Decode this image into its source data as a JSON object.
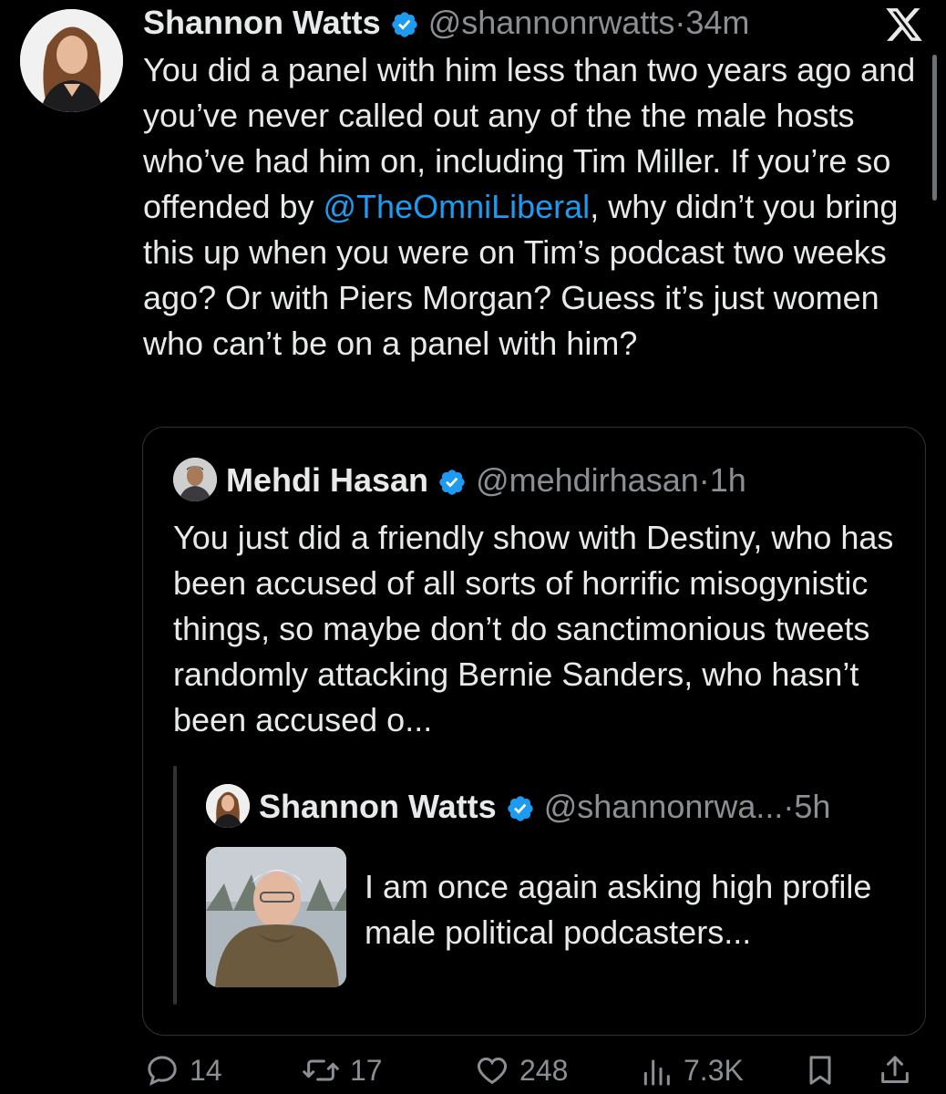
{
  "main_tweet": {
    "author_name": "Shannon Watts",
    "handle": "@shannonrwatts",
    "separator": "·",
    "time": "34m",
    "text_before_mention": "You did a panel with him less than two years ago and you’ve never called out any of the the male hosts who’ve had him on, including Tim Miller. If you’re so offended by ",
    "mention": "@TheOmniLiberal",
    "text_after_mention": ", why didn’t you bring this up when you were on Tim’s podcast two weeks ago? Or with Piers Morgan? Guess it’s just women who can’t be on a panel with him?"
  },
  "quoted_tweet": {
    "author_name": "Mehdi Hasan",
    "handle": "@mehdirhasan",
    "separator": "·",
    "time": "1h",
    "text": "You just did a friendly show with Destiny, who has been accused of all sorts of horrific misogynistic things, so maybe don’t do sanctimonious tweets randomly attacking Bernie Sanders, who hasn’t been accused o..."
  },
  "nested_quote": {
    "author_name": "Shannon Watts",
    "handle": "@shannonrwa...",
    "separator": "·",
    "time": "5h",
    "text": "I am once again asking high profile male political podcasters..."
  },
  "actions": {
    "replies": "14",
    "reposts": "17",
    "likes": "248",
    "views": "7.3K"
  },
  "icons": [
    "verified-badge-icon",
    "x-logo-icon",
    "reply-icon",
    "repost-icon",
    "like-icon",
    "views-icon",
    "bookmark-icon",
    "share-icon"
  ],
  "colors": {
    "background": "#000000",
    "text": "#e7e9ea",
    "secondary": "#8b8f94",
    "link": "#1d9bf0",
    "verified": "#1d9bf0",
    "border": "#2f3336"
  }
}
